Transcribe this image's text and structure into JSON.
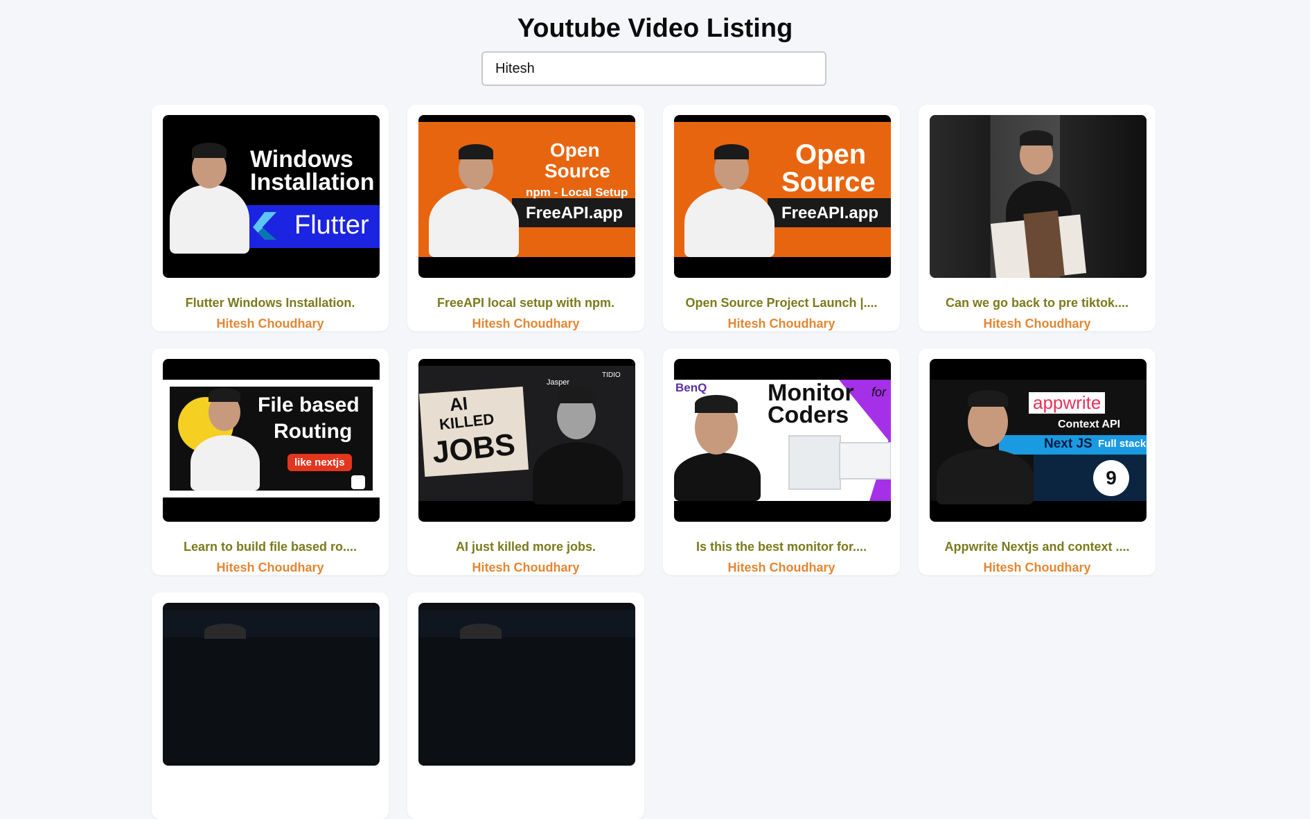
{
  "page": {
    "title": "Youtube Video Listing"
  },
  "search": {
    "value": "Hitesh"
  },
  "videos": [
    {
      "title": "Flutter Windows Installation.",
      "channel": "Hitesh Choudhary",
      "thumb_text": [
        "Windows",
        "Installation",
        "Flutter"
      ]
    },
    {
      "title": "FreeAPI local setup with npm.",
      "channel": "Hitesh Choudhary",
      "thumb_text": [
        "Open",
        "Source",
        "npm - Local Setup",
        "FreeAPI.app"
      ]
    },
    {
      "title": "Open Source Project Launch |....",
      "channel": "Hitesh Choudhary",
      "thumb_text": [
        "Open",
        "Source",
        "FreeAPI.app"
      ]
    },
    {
      "title": "Can we go back to pre tiktok....",
      "channel": "Hitesh Choudhary",
      "thumb_text": []
    },
    {
      "title": "Learn to build file based ro....",
      "channel": "Hitesh Choudhary",
      "thumb_text": [
        "File based",
        "Routing",
        "like nextjs"
      ]
    },
    {
      "title": "AI just killed more jobs.",
      "channel": "Hitesh Choudhary",
      "thumb_text": [
        "AI",
        "KILLED",
        "JOBS",
        "Jasper",
        "TIDIO"
      ]
    },
    {
      "title": "Is this the best monitor for....",
      "channel": "Hitesh Choudhary",
      "thumb_text": [
        "BenQ",
        "Monitor",
        "Coders",
        "for"
      ]
    },
    {
      "title": "Appwrite Nextjs and context ....",
      "channel": "Hitesh Choudhary",
      "thumb_text": [
        "appwrite",
        "Context API",
        "Next JS",
        "Full stack",
        "9"
      ]
    }
  ],
  "colors": {
    "title": "#7a7a1c",
    "channel": "#e38633",
    "orange": "#e8650f",
    "blue": "#1b24e0"
  }
}
